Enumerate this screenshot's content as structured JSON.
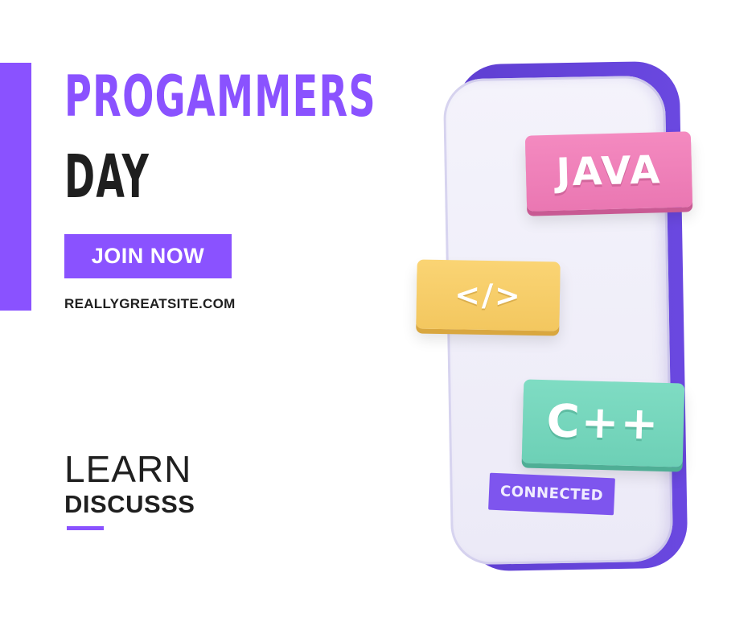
{
  "header": {
    "title_line_1": "PROGAMMERS",
    "title_line_2": "DAY"
  },
  "cta": {
    "join_label": "JOIN NOW",
    "website": "REALLYGREATSITE.COM"
  },
  "footer": {
    "learn": "LEARN",
    "discuss": "DISCUSSS"
  },
  "illustration": {
    "tags": {
      "java": "JAVA",
      "code": "</>",
      "cpp": "C++",
      "connected": "CONNECTED"
    }
  },
  "colors": {
    "accent": "#8a52ff",
    "text": "#1f1f1f",
    "java": "#ef80b9",
    "code": "#f6cd68",
    "cpp": "#76d6bc",
    "phone_frame": "#6545d9"
  }
}
